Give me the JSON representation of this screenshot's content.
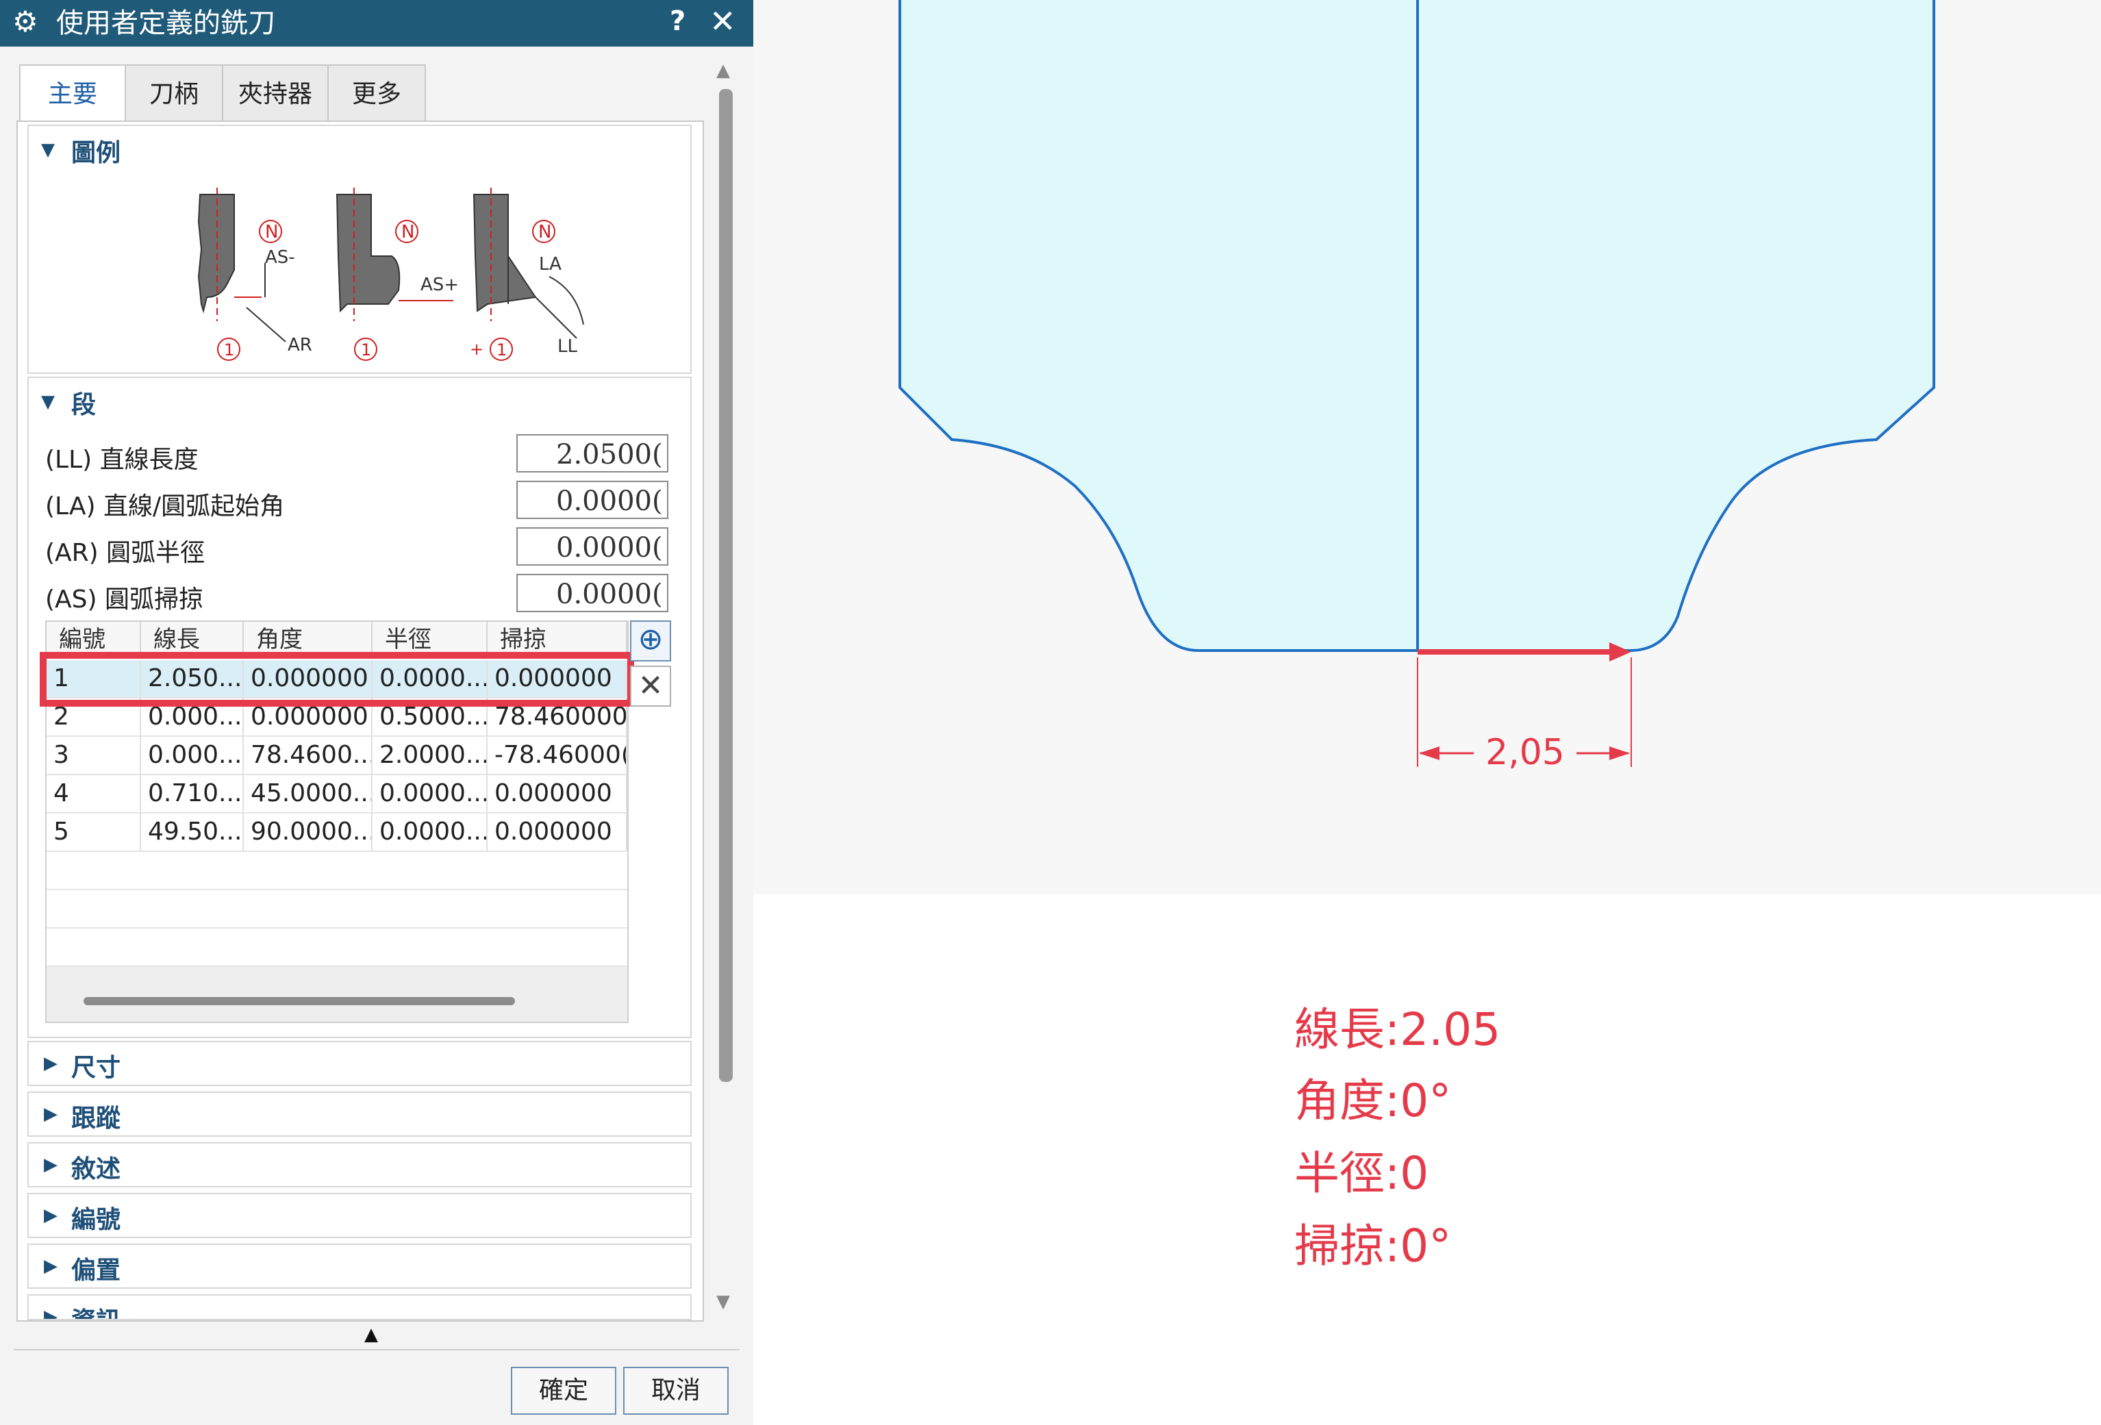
{
  "dialog": {
    "title": "使用者定義的銑刀",
    "help": "?",
    "close": "✕",
    "tabs": [
      "主要",
      "刀柄",
      "夾持器",
      "更多"
    ],
    "legend_group": {
      "title": "圖例",
      "figure_labels": [
        "AS-",
        "AR",
        "AS+",
        "LA",
        "LL",
        "N",
        "1",
        "+"
      ]
    },
    "segment_group": {
      "title": "段",
      "params": [
        {
          "label": "(LL) 直線長度",
          "value": "2.0500("
        },
        {
          "label": "(LA) 直線/圓弧起始角",
          "value": "0.0000("
        },
        {
          "label": "(AR) 圓弧半徑",
          "value": "0.0000("
        },
        {
          "label": "(AS) 圓弧掃掠",
          "value": "0.0000("
        }
      ],
      "columns": [
        "編號",
        "線長",
        "角度",
        "半徑",
        "掃掠"
      ],
      "rows": [
        [
          "1",
          "2.050...",
          "0.000000",
          "0.0000...",
          "0.000000"
        ],
        [
          "2",
          "0.000...",
          "0.000000",
          "0.5000...",
          "78.460000"
        ],
        [
          "3",
          "0.000...",
          "78.4600...",
          "2.0000...",
          "-78.46000("
        ],
        [
          "4",
          "0.710...",
          "45.0000...",
          "0.0000...",
          "0.000000"
        ],
        [
          "5",
          "49.50...",
          "90.0000...",
          "0.0000...",
          "0.000000"
        ]
      ],
      "add_icon": "⊕",
      "delete_icon": "✕"
    },
    "collapsed_groups": [
      "尺寸",
      "跟蹤",
      "敘述",
      "編號",
      "偏置",
      "資訊"
    ],
    "ok_label": "確定",
    "cancel_label": "取消"
  },
  "drawing": {
    "dimension_label": "2,05"
  },
  "notes": [
    "線長:2.05",
    "角度:0°",
    "半徑:0",
    "掃掠:0°"
  ],
  "colors": {
    "titlebar": "#1f5a78",
    "accent_red": "#e53a4a",
    "tool_fill": "#dff8fa",
    "tool_stroke": "#1f6fc4"
  }
}
